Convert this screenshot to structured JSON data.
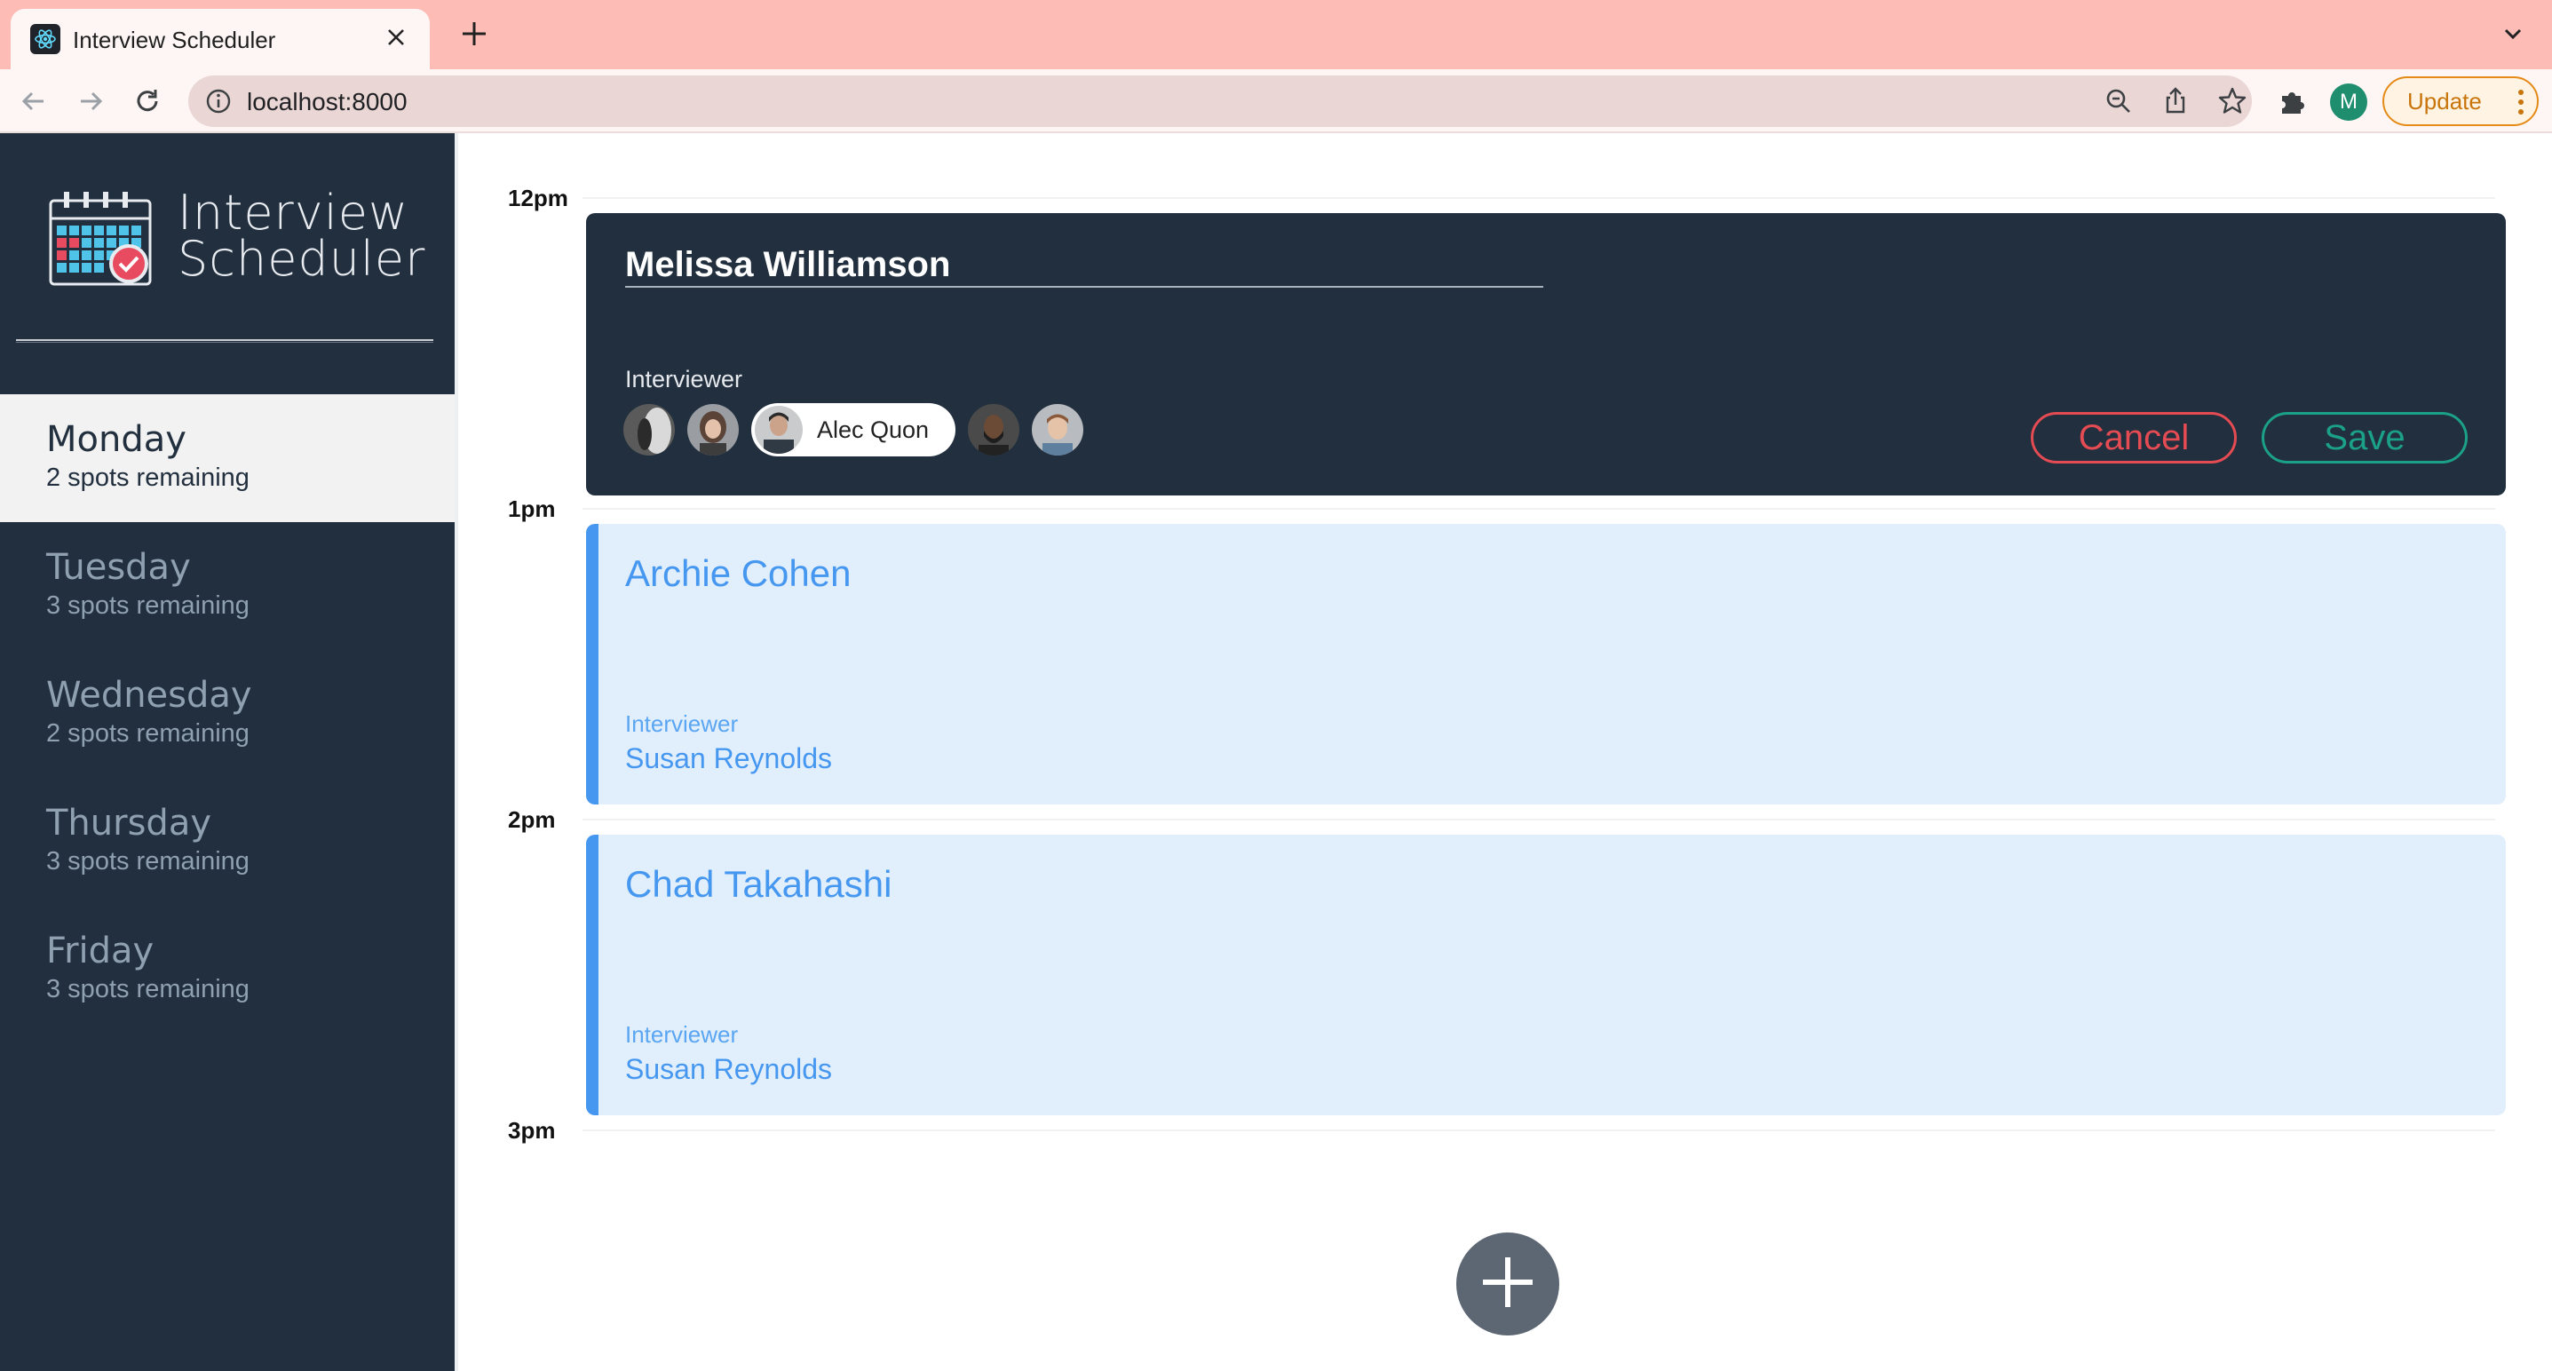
{
  "browser": {
    "tab_title": "Interview Scheduler",
    "url": "localhost:8000",
    "profile_initial": "M",
    "update_label": "Update"
  },
  "sidebar": {
    "brand_line1": "Interview",
    "brand_line2": "Scheduler",
    "days": [
      {
        "name": "Monday",
        "spots": "2 spots remaining",
        "selected": true
      },
      {
        "name": "Tuesday",
        "spots": "3 spots remaining",
        "selected": false
      },
      {
        "name": "Wednesday",
        "spots": "2 spots remaining",
        "selected": false
      },
      {
        "name": "Thursday",
        "spots": "3 spots remaining",
        "selected": false
      },
      {
        "name": "Friday",
        "spots": "3 spots remaining",
        "selected": false
      }
    ]
  },
  "schedule": {
    "times": [
      "12pm",
      "1pm",
      "2pm",
      "3pm"
    ],
    "form": {
      "student_name": "Melissa Williamson",
      "interviewer_label": "Interviewer",
      "selected_interviewer": "Alec Quon",
      "interviewers": [
        "interviewer-1",
        "interviewer-2",
        "Alec Quon",
        "interviewer-4",
        "interviewer-5"
      ],
      "cancel_label": "Cancel",
      "save_label": "Save"
    },
    "appointments": [
      {
        "student": "Archie Cohen",
        "interviewer_label": "Interviewer",
        "interviewer": "Susan Reynolds"
      },
      {
        "student": "Chad Takahashi",
        "interviewer_label": "Interviewer",
        "interviewer": "Susan Reynolds"
      }
    ]
  },
  "colors": {
    "sidebar_bg": "#222f3e",
    "appt_accent": "#4597f0",
    "cancel": "#e44b52",
    "save": "#1ba187"
  }
}
